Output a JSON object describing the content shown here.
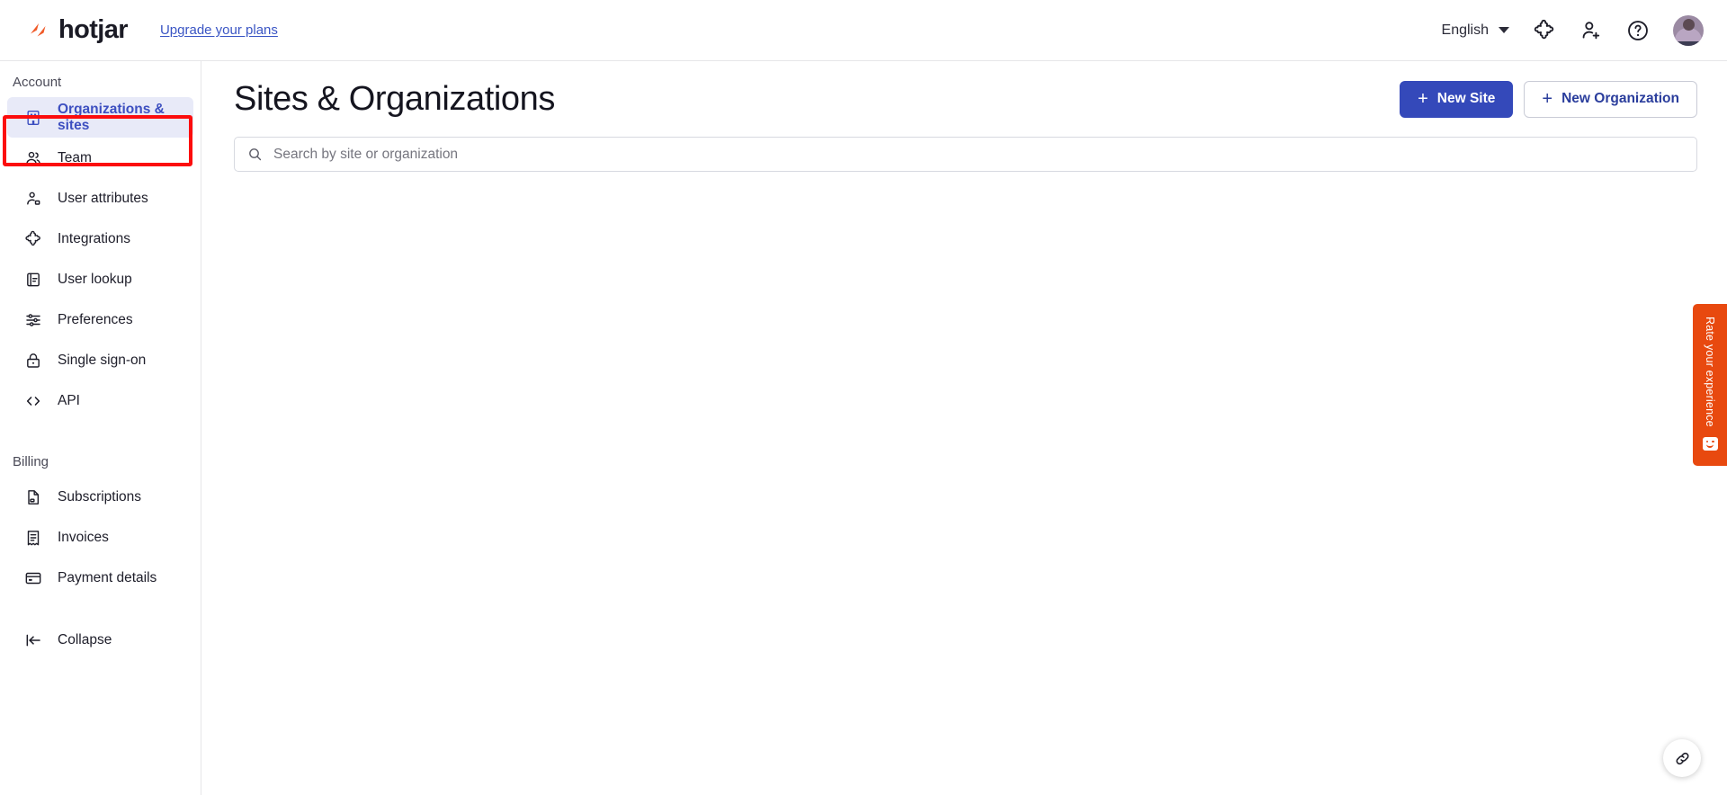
{
  "topbar": {
    "brand_name": "hotjar",
    "upgrade_link": "Upgrade your plans",
    "language": "English",
    "icons": {
      "integrations": "puzzle-icon",
      "invite": "add-user-icon",
      "help": "help-circle-icon",
      "avatar": "user-avatar"
    }
  },
  "sidebar": {
    "groups": [
      {
        "label": "Account",
        "items": [
          {
            "label": "Organizations & sites",
            "icon": "building-icon",
            "active": true
          },
          {
            "label": "Team",
            "icon": "people-icon",
            "active": false
          },
          {
            "label": "User attributes",
            "icon": "user-attribute-icon",
            "active": false
          },
          {
            "label": "Integrations",
            "icon": "puzzle-icon",
            "active": false
          },
          {
            "label": "User lookup",
            "icon": "user-lookup-icon",
            "active": false
          },
          {
            "label": "Preferences",
            "icon": "sliders-icon",
            "active": false
          },
          {
            "label": "Single sign-on",
            "icon": "lock-icon",
            "active": false
          },
          {
            "label": "API",
            "icon": "code-icon",
            "active": false
          }
        ]
      },
      {
        "label": "Billing",
        "items": [
          {
            "label": "Subscriptions",
            "icon": "document-icon",
            "active": false
          },
          {
            "label": "Invoices",
            "icon": "receipt-icon",
            "active": false
          },
          {
            "label": "Payment details",
            "icon": "credit-card-icon",
            "active": false
          }
        ]
      }
    ],
    "collapse": {
      "label": "Collapse",
      "icon": "collapse-left-icon"
    }
  },
  "main": {
    "page_title": "Sites & Organizations",
    "new_site_button": "New Site",
    "new_organization_button": "New Organization",
    "plus_glyph": "+",
    "search": {
      "placeholder": "Search by site or organization",
      "value": "",
      "icon": "search-icon"
    }
  },
  "feedback_tab": {
    "label": "Rate your experience",
    "icon": "smiley-face-icon",
    "color": "#e8490f"
  },
  "floating_button": {
    "icon": "link-icon"
  },
  "colors": {
    "accent_blue": "#3449ba",
    "active_nav_bg": "#e8eaf8",
    "active_nav_text": "#3d4fc0",
    "brand_orange": "#e8490f",
    "highlight_red": "#fc0d0d"
  }
}
